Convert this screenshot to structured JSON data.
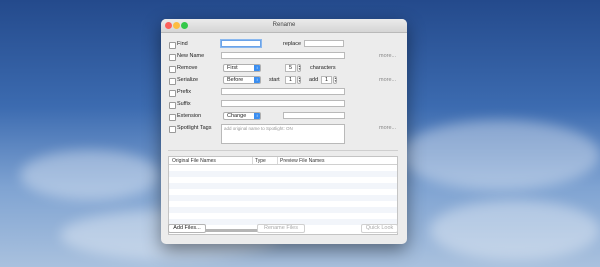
{
  "window": {
    "title": "Rename"
  },
  "rows": {
    "find": {
      "label": "Find",
      "replace_label": "replace",
      "find_value": "",
      "replace_value": ""
    },
    "new_name": {
      "label": "New Name",
      "value": "",
      "more": "more..."
    },
    "remove": {
      "label": "Remove",
      "position": "First",
      "count": "5",
      "unit": "characters"
    },
    "serialize": {
      "label": "Serialize",
      "position": "Before",
      "start_label": "start",
      "start": "1",
      "add_label": "add",
      "add": "1",
      "more": "more..."
    },
    "prefix": {
      "label": "Prefix",
      "value": ""
    },
    "suffix": {
      "label": "Suffix",
      "value": ""
    },
    "extension": {
      "label": "Extension",
      "mode": "Change",
      "value": ""
    },
    "spotlight": {
      "label": "Spotlight Tags",
      "placeholder": "add original name to Spotlight: ON",
      "more": "more..."
    }
  },
  "table": {
    "columns": [
      "Original File Names",
      "Type",
      "Preview File Names"
    ]
  },
  "footer": {
    "add_files": "Add Files...",
    "rename_files": "Rename Files",
    "quick_look": "Quick Look"
  },
  "colors": {
    "close": "#fc605b",
    "minimize": "#fdbc40",
    "zoom": "#34c84a",
    "accent": "#3b8ef0"
  },
  "icons": {
    "popup_arrow": "chevron-updown-icon"
  }
}
